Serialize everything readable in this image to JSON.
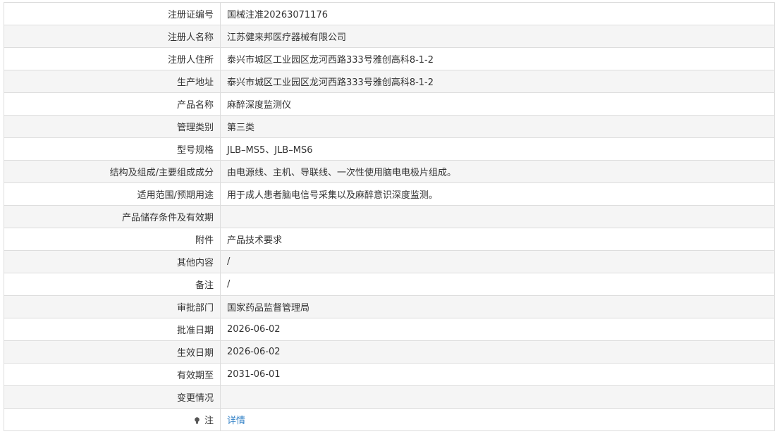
{
  "rows": [
    {
      "label": "注册证编号",
      "value": "国械注准20263071176"
    },
    {
      "label": "注册人名称",
      "value": "江苏健来邦医疗器械有限公司"
    },
    {
      "label": "注册人住所",
      "value": "泰兴市城区工业园区龙河西路333号雅创高科8-1-2"
    },
    {
      "label": "生产地址",
      "value": "泰兴市城区工业园区龙河西路333号雅创高科8-1-2"
    },
    {
      "label": "产品名称",
      "value": "麻醉深度监测仪"
    },
    {
      "label": "管理类别",
      "value": "第三类"
    },
    {
      "label": "型号规格",
      "value": "JLB–MS5、JLB–MS6"
    },
    {
      "label": "结构及组成/主要组成成分",
      "value": "由电源线、主机、导联线、一次性使用脑电电极片组成。"
    },
    {
      "label": "适用范围/预期用途",
      "value": "用于成人患者脑电信号采集以及麻醉意识深度监测。"
    },
    {
      "label": "产品储存条件及有效期",
      "value": ""
    },
    {
      "label": "附件",
      "value": "产品技术要求"
    },
    {
      "label": "其他内容",
      "value": "/"
    },
    {
      "label": "备注",
      "value": "/"
    },
    {
      "label": "审批部门",
      "value": "国家药品监督管理局"
    },
    {
      "label": "批准日期",
      "value": "2026-06-02"
    },
    {
      "label": "生效日期",
      "value": "2026-06-02"
    },
    {
      "label": "有效期至",
      "value": "2031-06-01"
    },
    {
      "label": "变更情况",
      "value": ""
    },
    {
      "label": "注",
      "value": "详情",
      "icon": "lightbulb-icon"
    }
  ],
  "colors": {
    "border": "#dddddd",
    "stripe": "#f5f5f5",
    "text": "#333333",
    "link": "#2f7fc6"
  }
}
